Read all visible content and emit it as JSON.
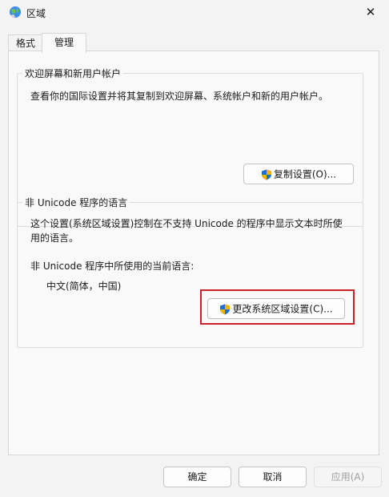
{
  "window": {
    "title": "区域",
    "icon": "globe-region-icon",
    "close_glyph": "✕"
  },
  "tabs": [
    {
      "label": "格式",
      "selected": false
    },
    {
      "label": "管理",
      "selected": true
    }
  ],
  "welcome_group": {
    "title": "欢迎屏幕和新用户帐户",
    "description": "查看你的国际设置并将其复制到欢迎屏幕、系统帐户和新的用户帐户。",
    "copy_button": "复制设置(O)..."
  },
  "unicode_group": {
    "title": "非 Unicode 程序的语言",
    "description_line1": "这个设置(系统区域设置)控制在不支持 Unicode 的程序中显示文本时所使",
    "description_line2": "用的语言。",
    "current_label": "非 Unicode 程序中所使用的当前语言:",
    "current_value": "中文(简体，中国)",
    "change_button": "更改系统区域设置(C)..."
  },
  "footer": {
    "ok": "确定",
    "cancel": "取消",
    "apply": "应用(A)"
  },
  "colors": {
    "highlight": "#d0202a",
    "shield_blue": "#1f6fd1",
    "shield_yellow": "#f2b400"
  }
}
